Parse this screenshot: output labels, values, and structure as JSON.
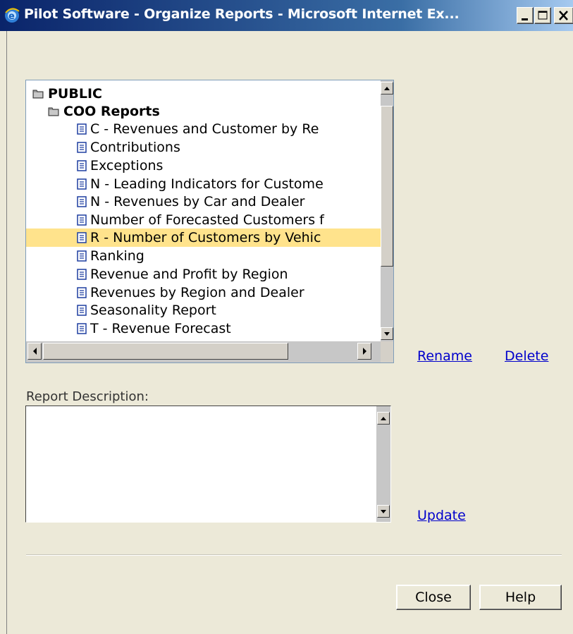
{
  "window": {
    "title": "Pilot Software - Organize Reports - Microsoft Internet Ex..."
  },
  "tree": {
    "root": "PUBLIC",
    "folder": "COO Reports",
    "items": [
      "C - Revenues and Customer by Re",
      "Contributions",
      "Exceptions",
      "N - Leading Indicators for Custome",
      "N - Revenues by Car and Dealer",
      "Number of Forecasted Customers f",
      "R - Number of Customers by Vehic",
      "Ranking",
      "Revenue and Profit by Region",
      "Revenues by Region and Dealer",
      "Seasonality Report",
      "T - Revenue Forecast"
    ],
    "selected_index": 6
  },
  "actions": {
    "rename": "Rename",
    "delete": "Delete",
    "update": "Update"
  },
  "description": {
    "label": "Report Description:",
    "value": ""
  },
  "buttons": {
    "close": "Close",
    "help": "Help"
  },
  "colors": {
    "selection": "#ffe38c",
    "link": "#0000cc",
    "title_bar": "#0a246a"
  },
  "icons": {
    "app": "ie-icon",
    "folder": "folder-icon",
    "report": "report-document-icon"
  }
}
